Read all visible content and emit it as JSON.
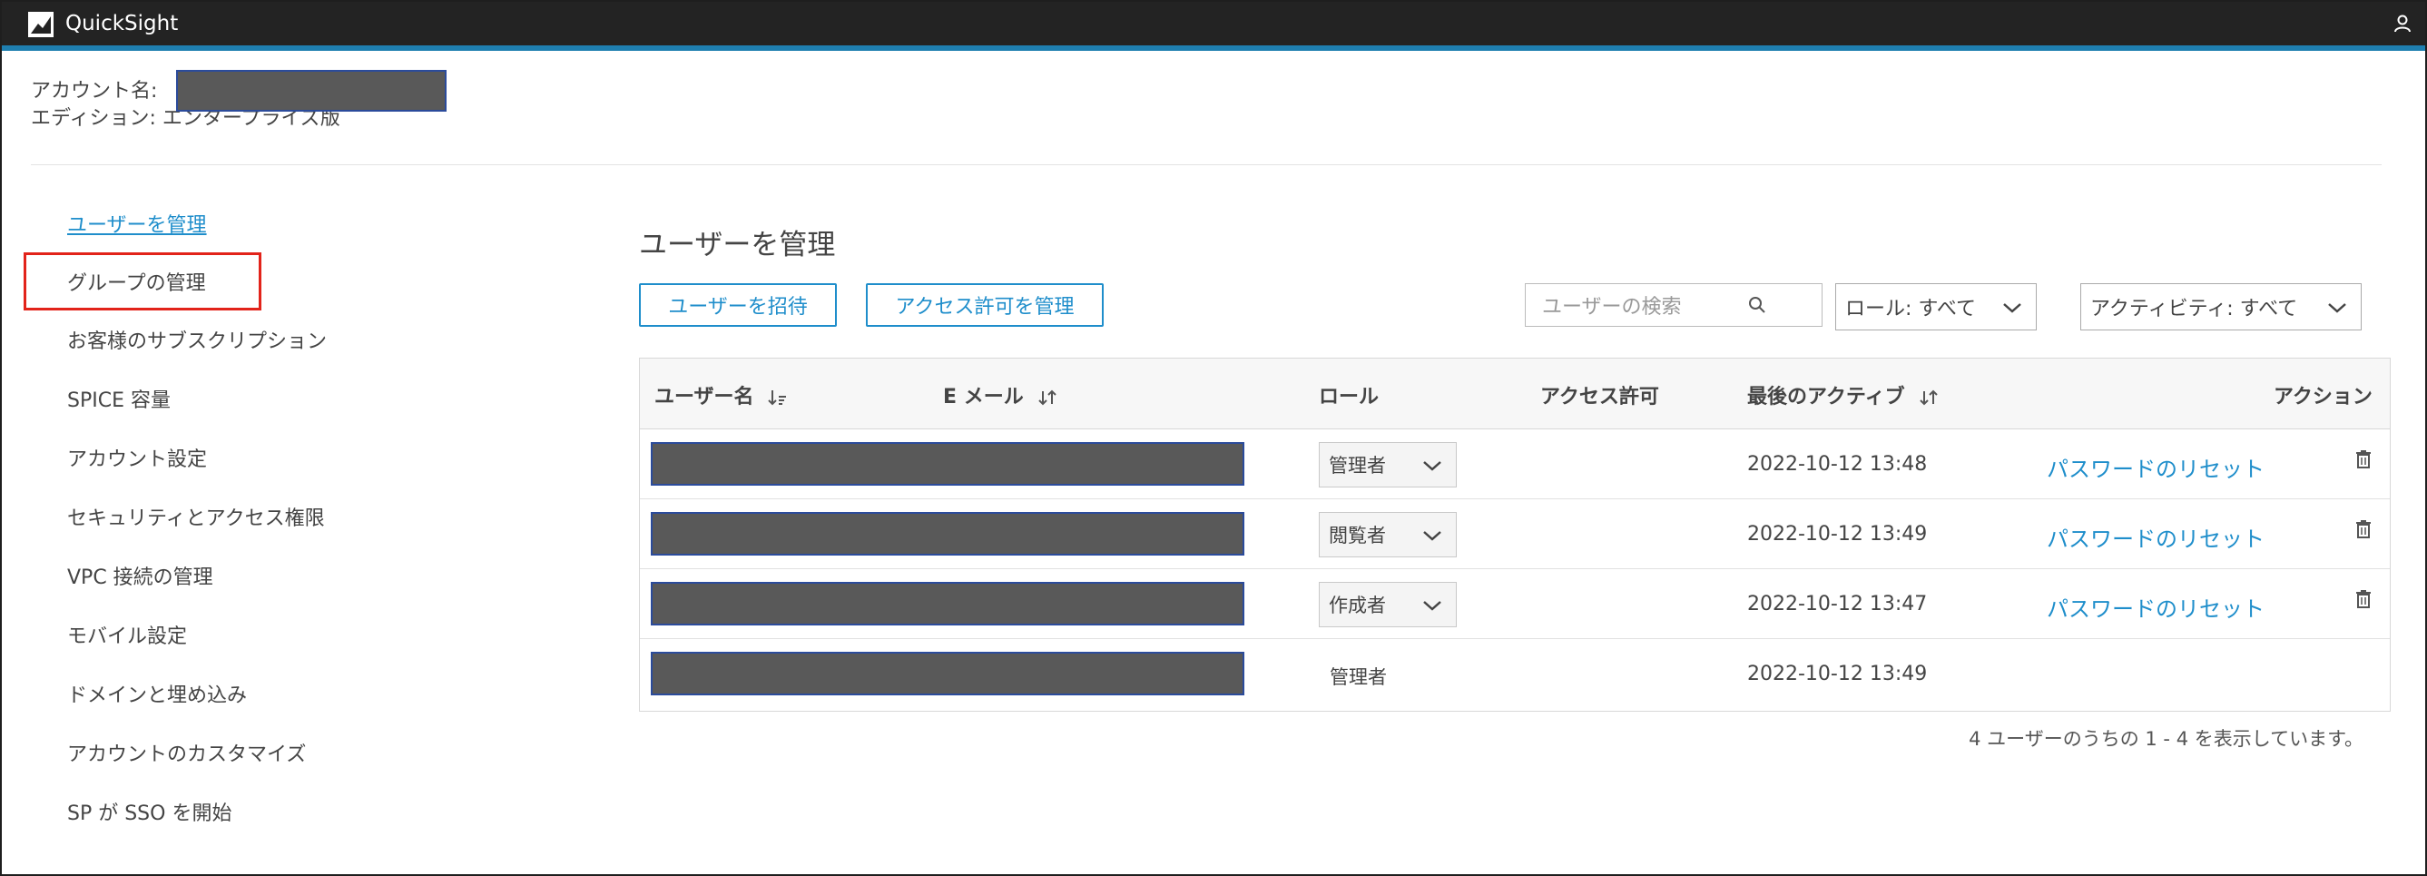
{
  "app": {
    "name": "QuickSight"
  },
  "account": {
    "name_label": "アカウント名:",
    "edition_label": "エディション: エンタープライズ版"
  },
  "sidebar": {
    "items": [
      {
        "label": "ユーザーを管理",
        "active": true
      },
      {
        "label": "グループの管理",
        "highlighted": true
      },
      {
        "label": "お客様のサブスクリプション"
      },
      {
        "label": "SPICE 容量"
      },
      {
        "label": "アカウント設定"
      },
      {
        "label": "セキュリティとアクセス権限"
      },
      {
        "label": "VPC 接続の管理"
      },
      {
        "label": "モバイル設定"
      },
      {
        "label": "ドメインと埋め込み"
      },
      {
        "label": "アカウントのカスタマイズ"
      },
      {
        "label": "SP が SSO を開始"
      }
    ]
  },
  "main": {
    "title": "ユーザーを管理",
    "invite_button": "ユーザーを招待",
    "manage_access_button": "アクセス許可を管理",
    "search_placeholder": "ユーザーの検索",
    "role_filter": "ロール: すべて",
    "activity_filter": "アクティビティ: すべて"
  },
  "table": {
    "columns": {
      "username": "ユーザー名",
      "email": "E メール",
      "role": "ロール",
      "access": "アクセス許可",
      "last_active": "最後のアクティブ",
      "action": "アクション"
    },
    "rows": [
      {
        "role": "管理者",
        "last_active": "2022-10-12 13:48",
        "action": "パスワードのリセット",
        "editable": true
      },
      {
        "role": "閲覧者",
        "last_active": "2022-10-12 13:49",
        "action": "パスワードのリセット",
        "editable": true
      },
      {
        "role": "作成者",
        "last_active": "2022-10-12 13:47",
        "action": "パスワードのリセット",
        "editable": true
      },
      {
        "role": "管理者",
        "last_active": "2022-10-12 13:49",
        "action": "",
        "editable": false
      }
    ],
    "footer": "4 ユーザーのうちの 1 - 4 を表示しています。"
  },
  "colors": {
    "accent": "#1f8ecb",
    "topbar": "#232323",
    "highlight": "#e2231a"
  }
}
